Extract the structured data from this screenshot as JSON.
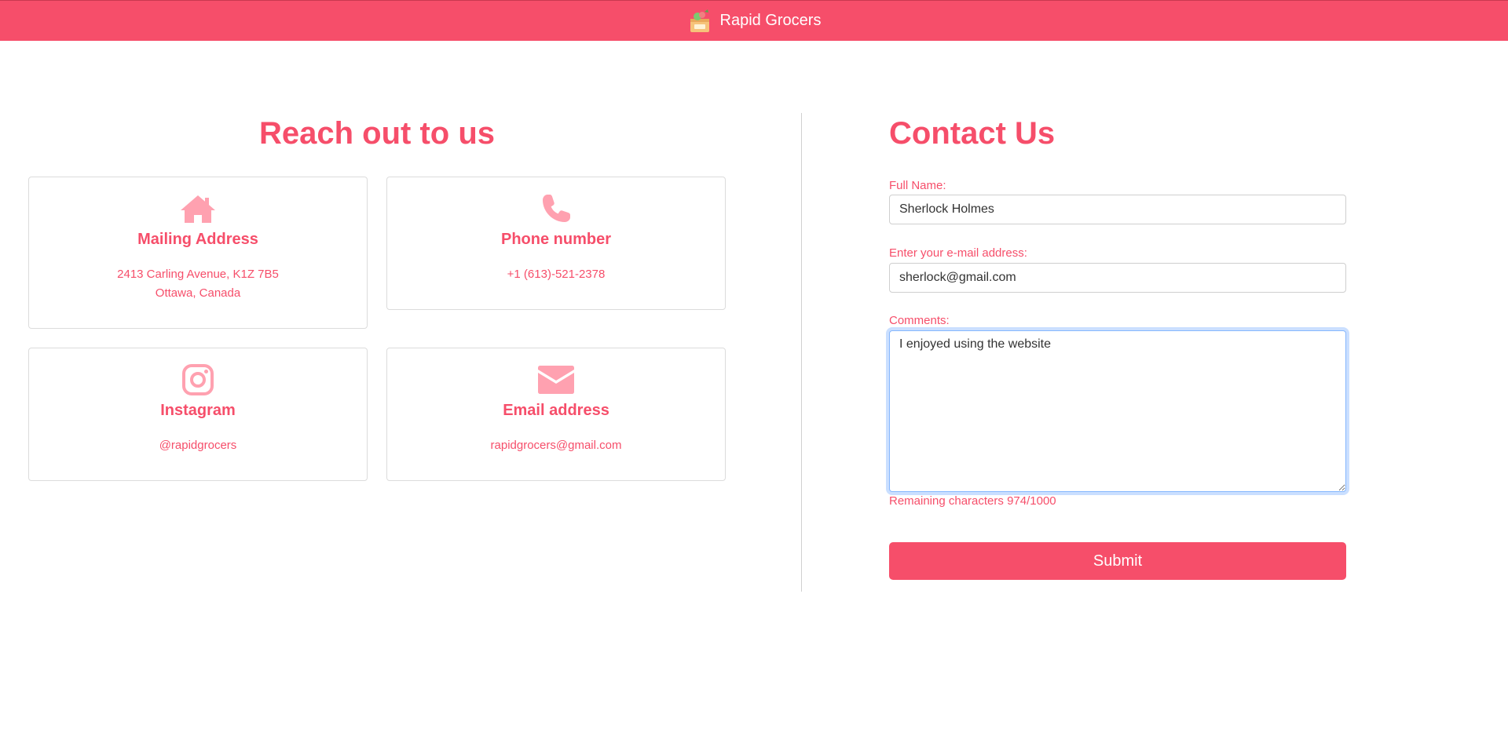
{
  "navbar": {
    "brand": "Rapid Grocers",
    "logo_icon": "grocery-basket-icon"
  },
  "left": {
    "title": "Reach out to us",
    "cards": [
      {
        "icon": "house-icon",
        "title": "Mailing Address",
        "lines": [
          "2413 Carling Avenue, K1Z 7B5",
          "Ottawa, Canada"
        ]
      },
      {
        "icon": "phone-icon",
        "title": "Phone number",
        "lines": [
          "+1 (613)-521-2378"
        ]
      },
      {
        "icon": "instagram-icon",
        "title": "Instagram",
        "lines": [
          "@rapidgrocers"
        ]
      },
      {
        "icon": "envelope-icon",
        "title": "Email address",
        "lines": [
          "rapidgrocers@gmail.com"
        ]
      }
    ]
  },
  "form": {
    "title": "Contact Us",
    "name_label": "Full Name:",
    "name_value": "Sherlock Holmes",
    "email_label": "Enter your e-mail address:",
    "email_value": "sherlock@gmail.com",
    "comments_label": "Comments:",
    "comments_value": "I enjoyed using the website",
    "counter": "Remaining characters 974/1000",
    "submit": "Submit"
  },
  "colors": {
    "accent": "#f64e6a",
    "icon_pink": "#ffa1b0",
    "focus_ring": "#86b7fe"
  }
}
